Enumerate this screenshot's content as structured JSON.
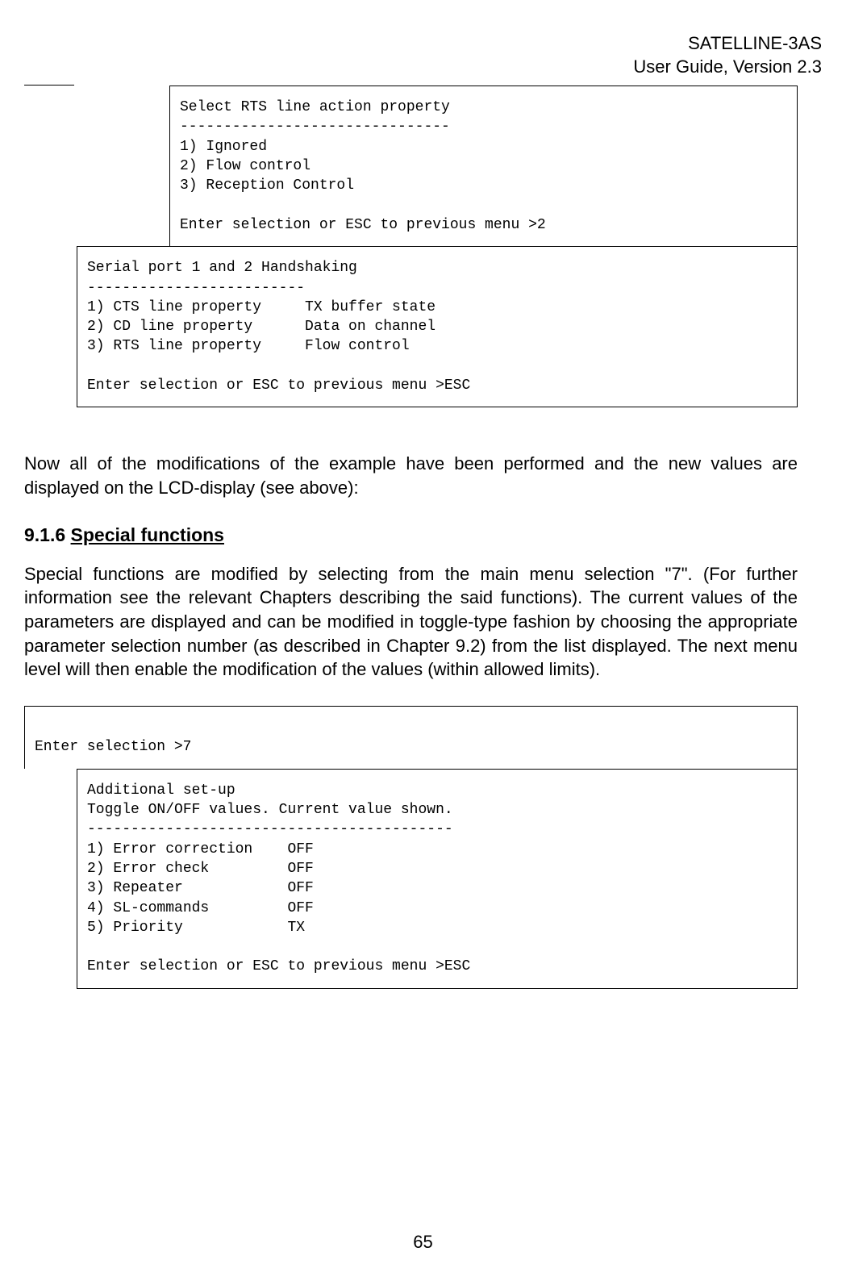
{
  "header": {
    "line1": "SATELLINE-3AS",
    "line2": "User Guide, Version 2.3"
  },
  "box1_text": "Select RTS line action property\n-------------------------------\n1) Ignored\n2) Flow control\n3) Reception Control\n\nEnter selection or ESC to previous menu >2",
  "box2_text": "Serial port 1 and 2 Handshaking\n-------------------------\n1) CTS line property     TX buffer state\n2) CD line property      Data on channel\n3) RTS line property     Flow control\n\nEnter selection or ESC to previous menu >ESC",
  "para1": "Now all of the modifications of the example have been performed and the new values are displayed on the LCD-display (see above):",
  "section": {
    "number": "9.1.6",
    "title": "Special functions"
  },
  "para2": "Special functions are modified by selecting from the main menu selection \"7\". (For further information see the relevant Chapters describing the said functions). The current values of the parameters are displayed and can be modified in toggle-type fashion by choosing the appropriate parameter selection number (as described in Chapter 9.2) from the list displayed. The next menu level will then enable the modification of the values (within allowed limits).",
  "box3_text": "\nEnter selection >7\n",
  "box4_text": "Additional set-up\nToggle ON/OFF values. Current value shown.\n------------------------------------------\n1) Error correction    OFF\n2) Error check         OFF\n3) Repeater            OFF\n4) SL-commands         OFF\n5) Priority            TX\n\nEnter selection or ESC to previous menu >ESC",
  "page_number": "65"
}
